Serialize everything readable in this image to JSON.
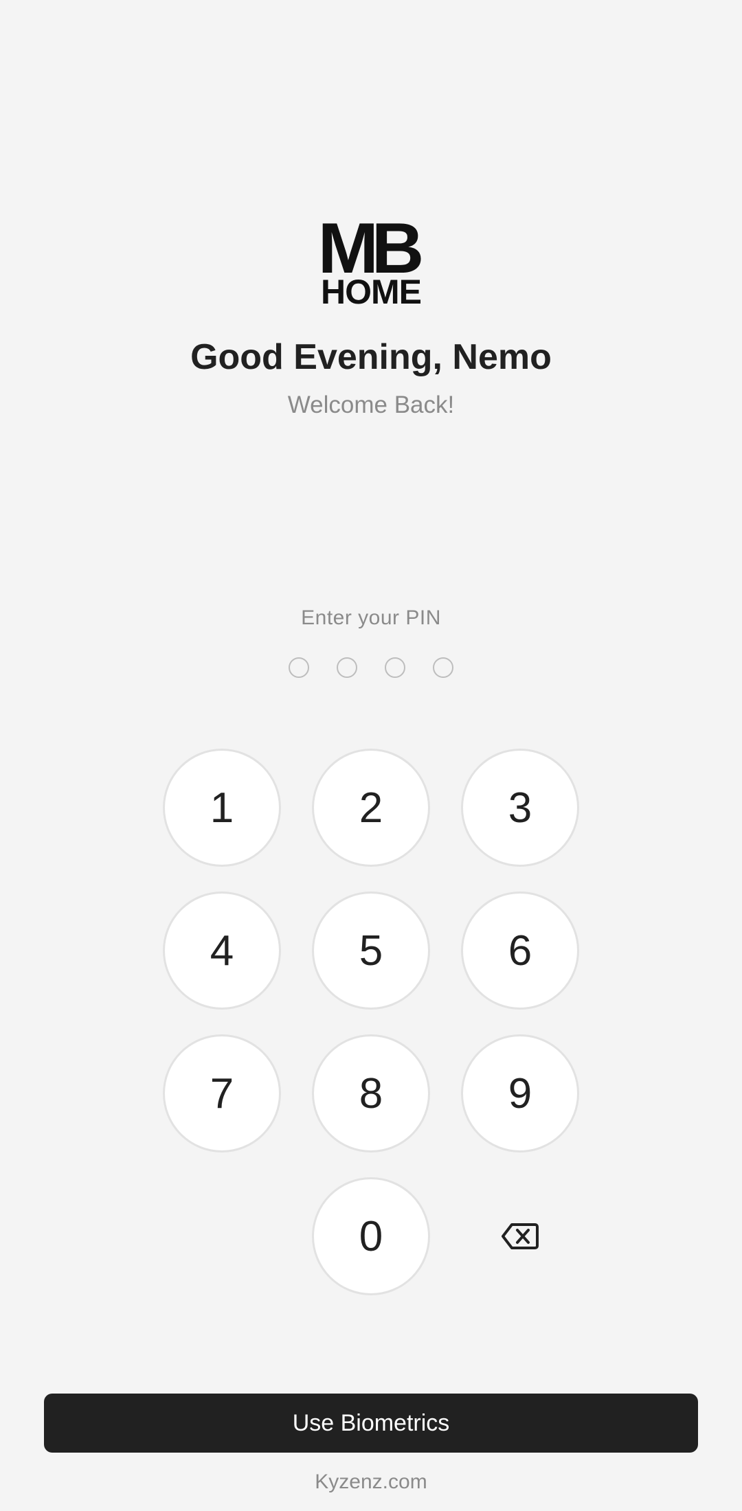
{
  "logo": {
    "line1": "MB",
    "line2": "HOME"
  },
  "header": {
    "greeting": "Good Evening, Nemo",
    "subtitle": "Welcome Back!"
  },
  "pin": {
    "label": "Enter your PIN",
    "length": 4,
    "entered": 0
  },
  "keypad": {
    "keys": [
      "1",
      "2",
      "3",
      "4",
      "5",
      "6",
      "7",
      "8",
      "9",
      "0"
    ],
    "backspace_icon": "backspace-icon"
  },
  "actions": {
    "biometrics_label": "Use Biometrics"
  },
  "footer": {
    "text": "Kyzenz.com"
  },
  "colors": {
    "background": "#f4f4f4",
    "primary_button": "#212121",
    "key_fill": "#ffffff",
    "key_border": "#e2e2e2",
    "muted_text": "#8a8a8a"
  }
}
